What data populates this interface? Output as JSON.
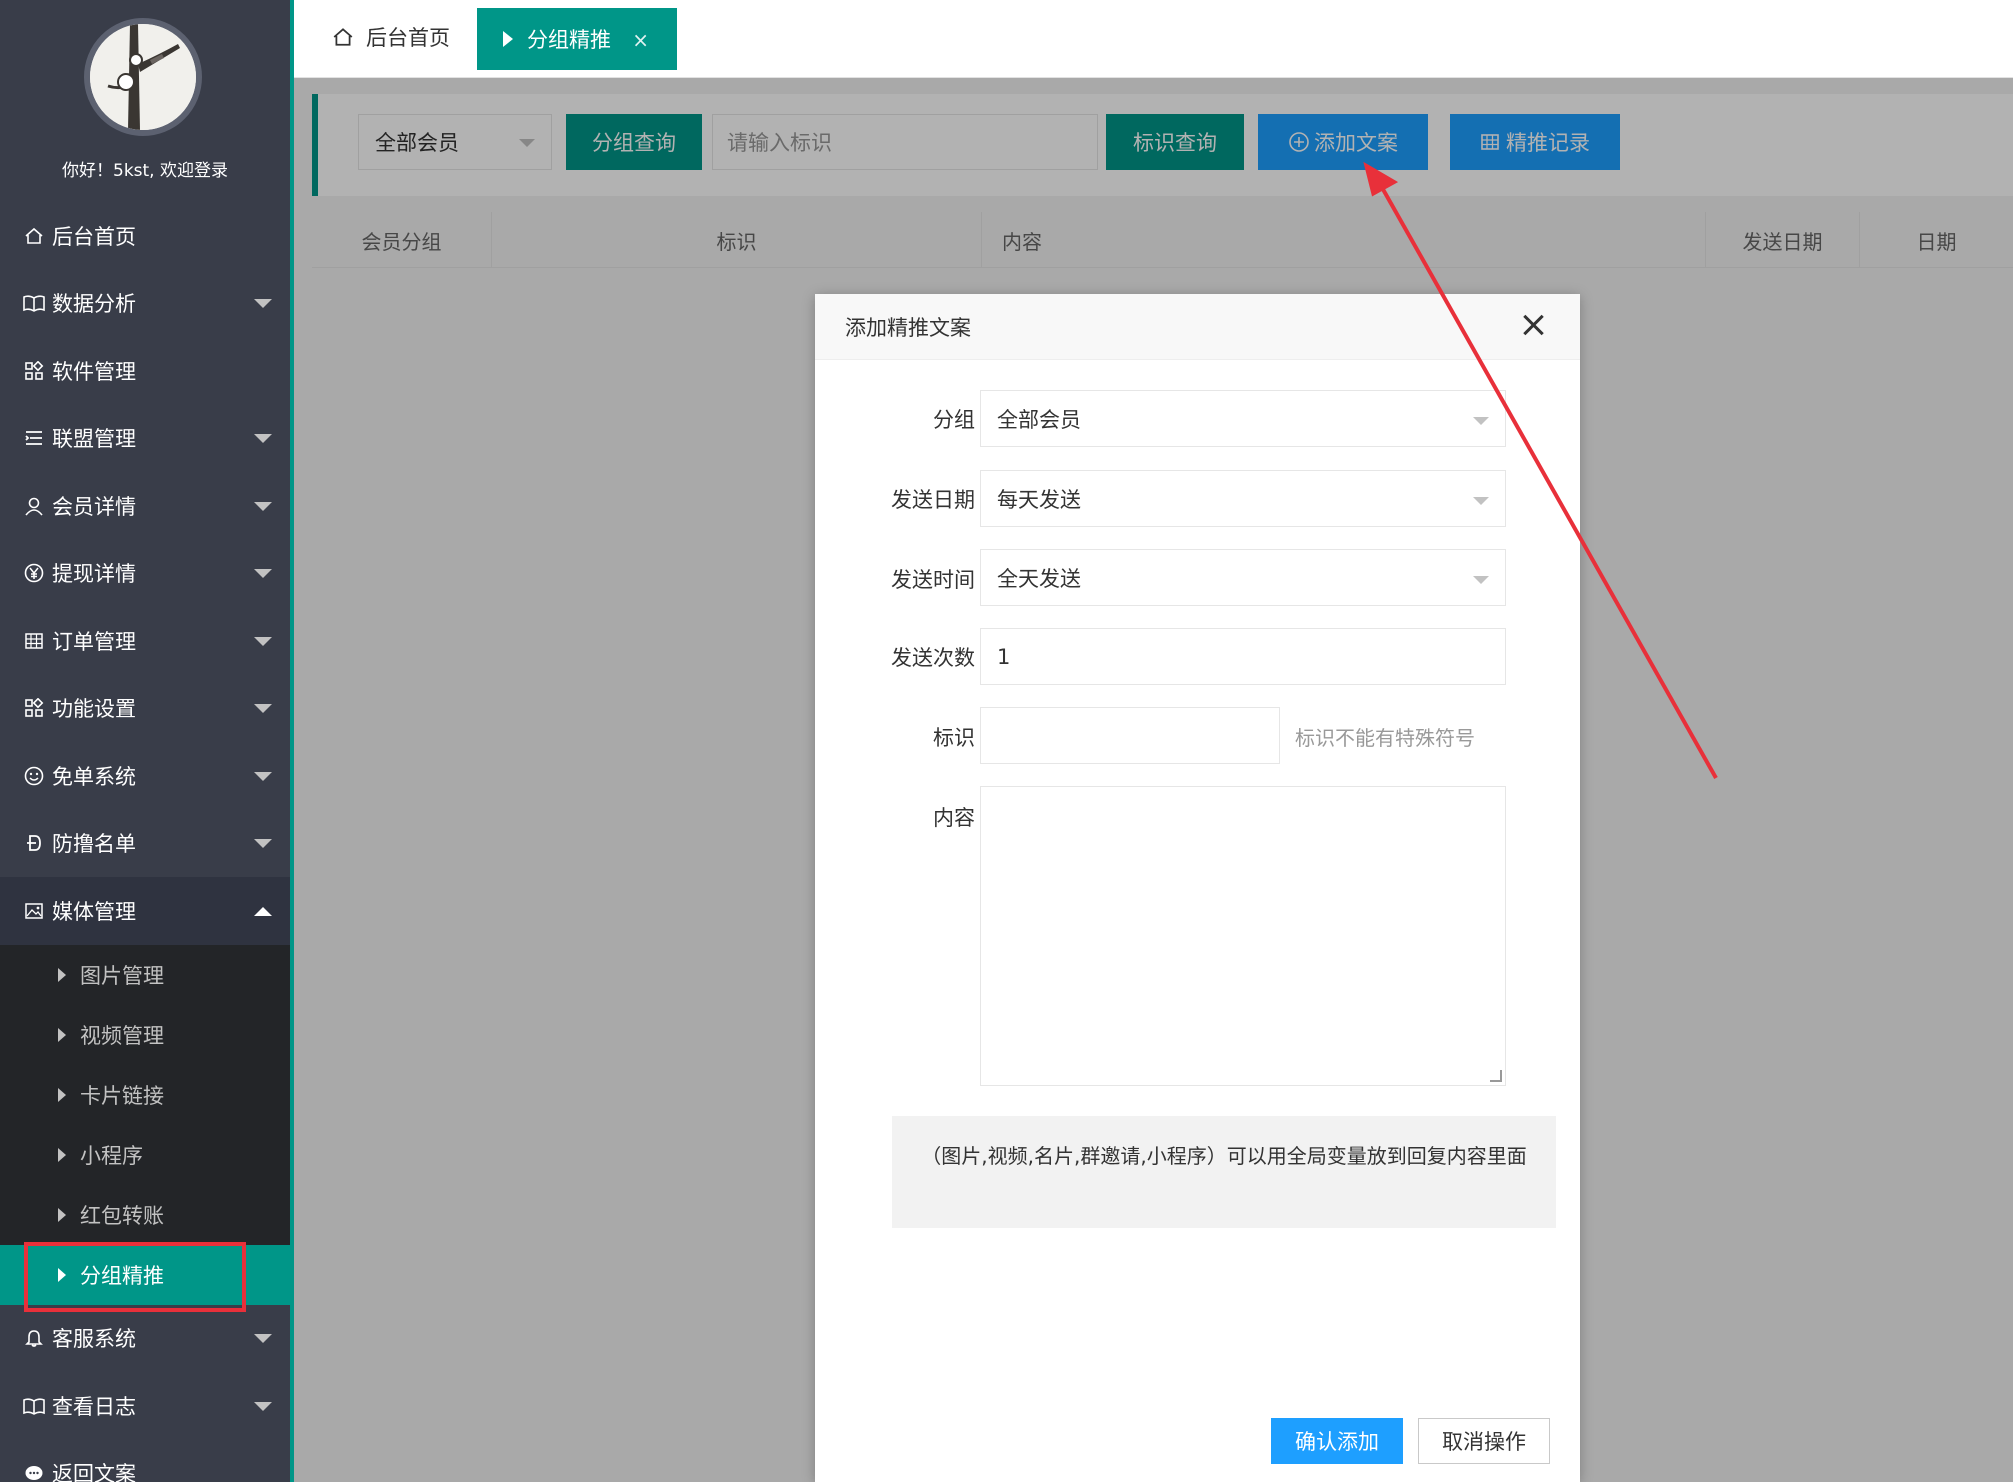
{
  "sidebar": {
    "welcome": "你好！5kst, 欢迎登录",
    "items": [
      {
        "label": "后台首页",
        "icon": "home-icon"
      },
      {
        "label": "数据分析",
        "icon": "book-icon"
      },
      {
        "label": "软件管理",
        "icon": "apps-icon"
      },
      {
        "label": "联盟管理",
        "icon": "list-icon"
      },
      {
        "label": "会员详情",
        "icon": "user-icon"
      },
      {
        "label": "提现详情",
        "icon": "yen-icon"
      },
      {
        "label": "订单管理",
        "icon": "grid-icon"
      },
      {
        "label": "功能设置",
        "icon": "apps-icon"
      },
      {
        "label": "免单系统",
        "icon": "smile-icon"
      },
      {
        "label": "防撸名单",
        "icon": "dollar-icon"
      },
      {
        "label": "媒体管理",
        "icon": "picture-icon"
      }
    ],
    "sub_items": [
      "图片管理",
      "视频管理",
      "卡片链接",
      "小程序",
      "红包转账",
      "分组精推"
    ],
    "bottom_items": [
      {
        "label": "客服系统",
        "icon": "bell-icon"
      },
      {
        "label": "查看日志",
        "icon": "book-icon"
      },
      {
        "label": "返回文案",
        "icon": "chat-icon"
      }
    ]
  },
  "tabs": {
    "home": "后台首页",
    "active": "分组精推",
    "close": "×"
  },
  "toolbar": {
    "group_select": "全部会员",
    "group_query": "分组查询",
    "mark_placeholder": "请输入标识",
    "mark_query": "标识查询",
    "add_copy": "添加文案",
    "push_record": "精推记录"
  },
  "table": {
    "headers": [
      "会员分组",
      "标识",
      "内容",
      "发送日期",
      "日期"
    ]
  },
  "modal": {
    "title": "添加精推文案",
    "fields": {
      "group_label": "分组",
      "group_value": "全部会员",
      "send_date_label": "发送日期",
      "send_date_value": "每天发送",
      "send_time_label": "发送时间",
      "send_time_value": "全天发送",
      "send_count_label": "发送次数",
      "send_count_value": "1",
      "mark_label": "标识",
      "mark_value": "",
      "mark_hint": "标识不能有特殊符号",
      "content_label": "内容"
    },
    "notice": "（图片,视频,名片,群邀请,小程序）可以用全局变量放到回复内容里面",
    "confirm": "确认添加",
    "cancel": "取消操作"
  },
  "colors": {
    "sidebar_bg": "#393d49",
    "accent_teal": "#009688",
    "accent_blue": "#1e9fff",
    "annotation_red": "#e8303a"
  }
}
